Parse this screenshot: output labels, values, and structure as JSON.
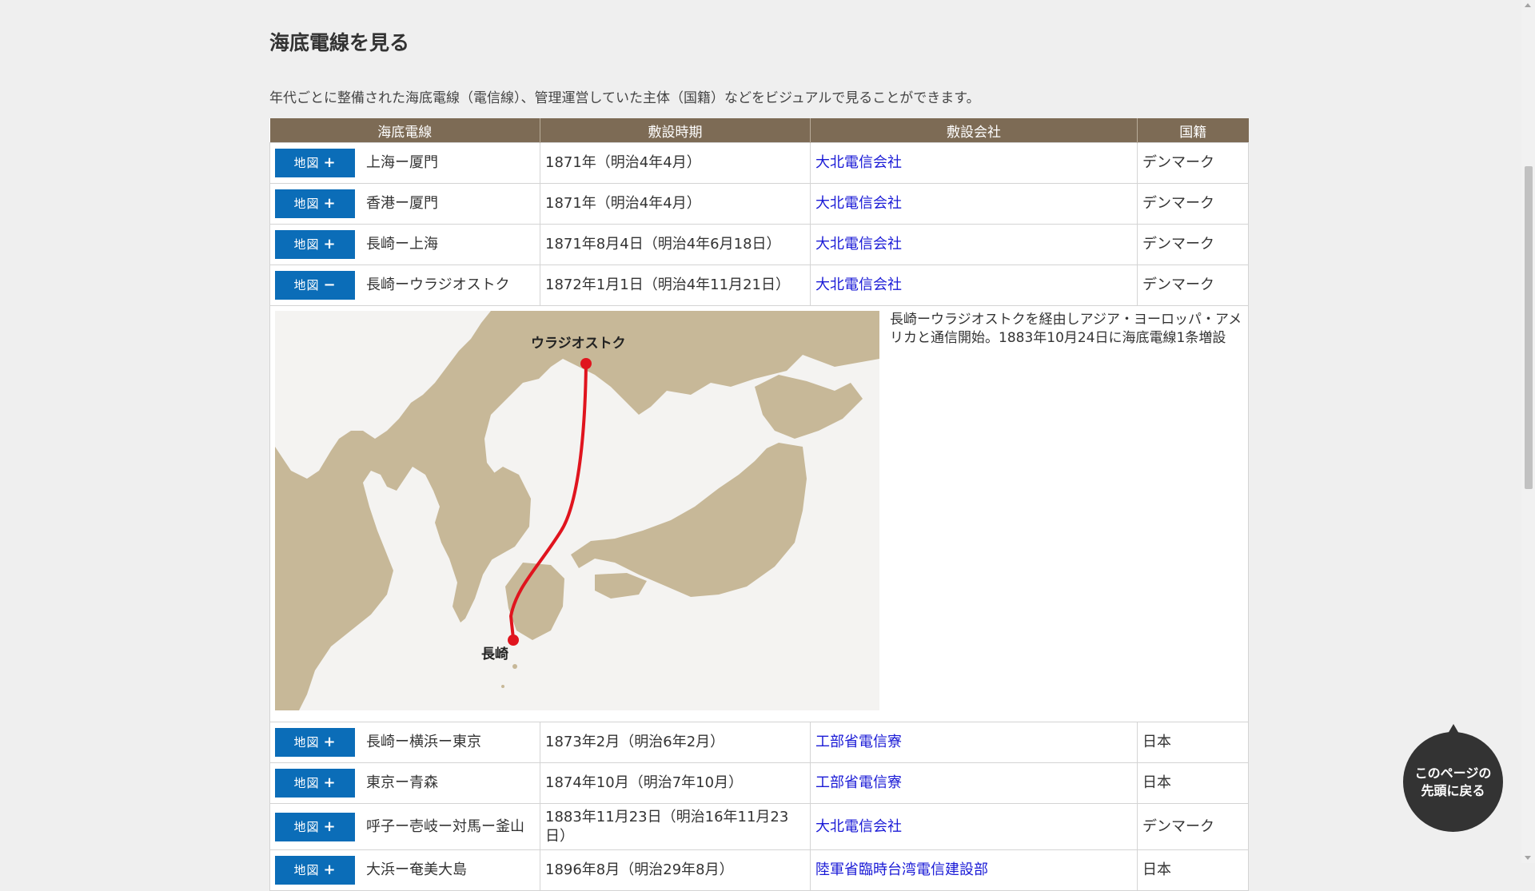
{
  "page": {
    "title": "海底電線を見る",
    "lead": "年代ごとに整備された海底電線（電信線）、管理運営していた主体（国籍）などをビジュアルで見ることができます。"
  },
  "table": {
    "headers": [
      "海底電線",
      "敷設時期",
      "敷設会社",
      "国籍"
    ],
    "map_label": "地図",
    "plus": "+",
    "minus": "−",
    "rows": [
      {
        "cable": "上海ー厦門",
        "period": "1871年（明治4年4月）",
        "company": "大北電信会社",
        "nationality": "デンマーク"
      },
      {
        "cable": "香港ー厦門",
        "period": "1871年（明治4年4月）",
        "company": "大北電信会社",
        "nationality": "デンマーク"
      },
      {
        "cable": "長崎ー上海",
        "period": "1871年8月4日（明治4年6月18日）",
        "company": "大北電信会社",
        "nationality": "デンマーク"
      },
      {
        "cable": "長崎ーウラジオストク",
        "period": "1872年1月1日（明治4年11月21日）",
        "company": "大北電信会社",
        "nationality": "デンマーク"
      },
      {
        "cable": "長崎ー横浜ー東京",
        "period": "1873年2月（明治6年2月）",
        "company": "工部省電信寮",
        "nationality": "日本"
      },
      {
        "cable": "東京ー青森",
        "period": "1874年10月（明治7年10月）",
        "company": "工部省電信寮",
        "nationality": "日本"
      },
      {
        "cable": "呼子ー壱岐ー対馬ー釜山",
        "period": "1883年11月23日（明治16年11月23日）",
        "company": "大北電信会社",
        "nationality": "デンマーク"
      },
      {
        "cable": "大浜ー奄美大島",
        "period": "1896年8月（明治29年8月）",
        "company": "陸軍省臨時台湾電信建設部",
        "nationality": "日本"
      }
    ],
    "expanded": {
      "description": "長崎ーウラジオストクを経由しアジア・ヨーロッパ・アメリカと通信開始。1883年10月24日に海底電線1条増設",
      "map_label_north": "ウラジオストク",
      "map_label_south": "長崎"
    }
  },
  "back_to_top": {
    "line1": "このページの",
    "line2": "先頭に戻る"
  },
  "colors": {
    "header_bg": "#7d6b55",
    "button_bg": "#0b6db8",
    "link": "#1a1ad6",
    "cable_line": "#e0141e",
    "sea": "#f4f3f1",
    "land": "#c7b898"
  },
  "icons": {
    "expand": "plus-icon",
    "collapse": "minus-icon",
    "back_top": "up-arrow-icon"
  }
}
